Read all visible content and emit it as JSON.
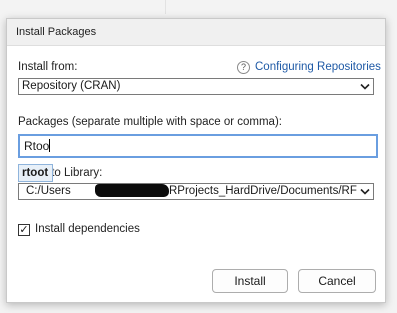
{
  "dialog": {
    "title": "Install Packages",
    "install_from_label": "Install from:",
    "help_icon_glyph": "?",
    "help_link": "Configuring Repositories",
    "install_from_value": "Repository (CRAN)",
    "packages_label": "Packages (separate multiple with space or comma):",
    "packages_value": "Rtoo",
    "autocomplete_item": "rtoot",
    "install_to_label": "Install to Library:",
    "library_path_prefix": "C:/Users",
    "library_path_suffix": "RProjects_HardDrive/Documents/RF",
    "install_dependencies_label": "Install dependencies",
    "install_dependencies_checked": true,
    "checkmark_glyph": "✓",
    "install_button": "Install",
    "cancel_button": "Cancel"
  },
  "colors": {
    "link": "#1f5aa6",
    "focus_border": "#6a9ee0"
  }
}
